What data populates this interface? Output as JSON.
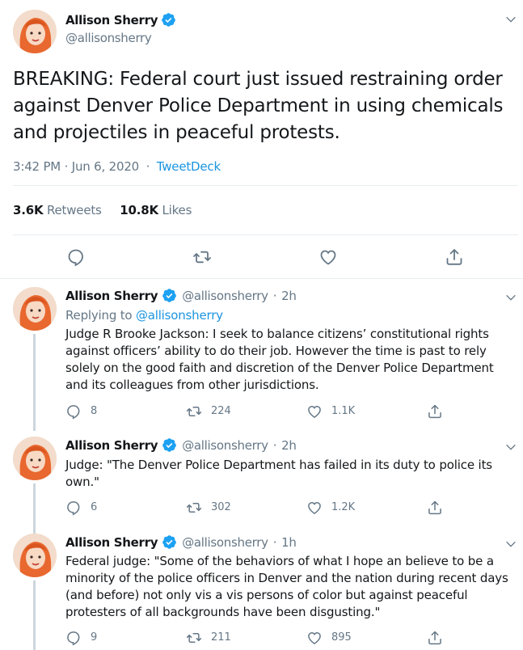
{
  "main_tweet": {
    "author_name": "Allison Sherry",
    "handle": "@allisonsherry",
    "verified_icon": "verified-badge-icon",
    "text": "BREAKING: Federal court just issued restraining order against Denver Police Department in using chemicals and projectiles in peaceful protests.",
    "timestamp": "3:42 PM · Jun 6, 2020",
    "separator": "·",
    "source": "TweetDeck",
    "retweets_count": "3.6K",
    "retweets_label": "Retweets",
    "likes_count": "10.8K",
    "likes_label": "Likes",
    "actions": [
      "reply-icon",
      "retweet-icon",
      "like-icon",
      "share-icon"
    ]
  },
  "replies": [
    {
      "author_name": "Allison Sherry",
      "handle": "@allisonsherry",
      "dot": "·",
      "time": "2h",
      "replying_prefix": "Replying to",
      "replying_to": "@allisonsherry",
      "text": "Judge R Brooke Jackson: I seek to balance citizens’ constitutional rights against officers’ ability to do their job. However the time is past to rely solely on the good faith and discretion of the Denver Police Department and its colleagues from other jurisdictions.",
      "reply_count": "8",
      "retweet_count": "224",
      "like_count": "1.1K"
    },
    {
      "author_name": "Allison Sherry",
      "handle": "@allisonsherry",
      "dot": "·",
      "time": "2h",
      "text": "Judge: \"The Denver Police Department has failed in its duty to police its own.\"",
      "reply_count": "6",
      "retweet_count": "302",
      "like_count": "1.2K"
    },
    {
      "author_name": "Allison Sherry",
      "handle": "@allisonsherry",
      "dot": "·",
      "time": "1h",
      "text": "Federal judge: \"Some of the behaviors of what I hope an believe to be a minority of the police officers in Denver and the nation during recent days (and before) not only vis a vis persons of color but against peaceful protesters of all backgrounds have been disgusting.\"",
      "reply_count": "9",
      "retweet_count": "211",
      "like_count": "895"
    }
  ],
  "colors": {
    "link": "#1b95e0",
    "verified": "#1da1f2",
    "secondary_text": "#657786",
    "divider": "#e6ecf0",
    "thread_line": "#ccd6dd"
  }
}
